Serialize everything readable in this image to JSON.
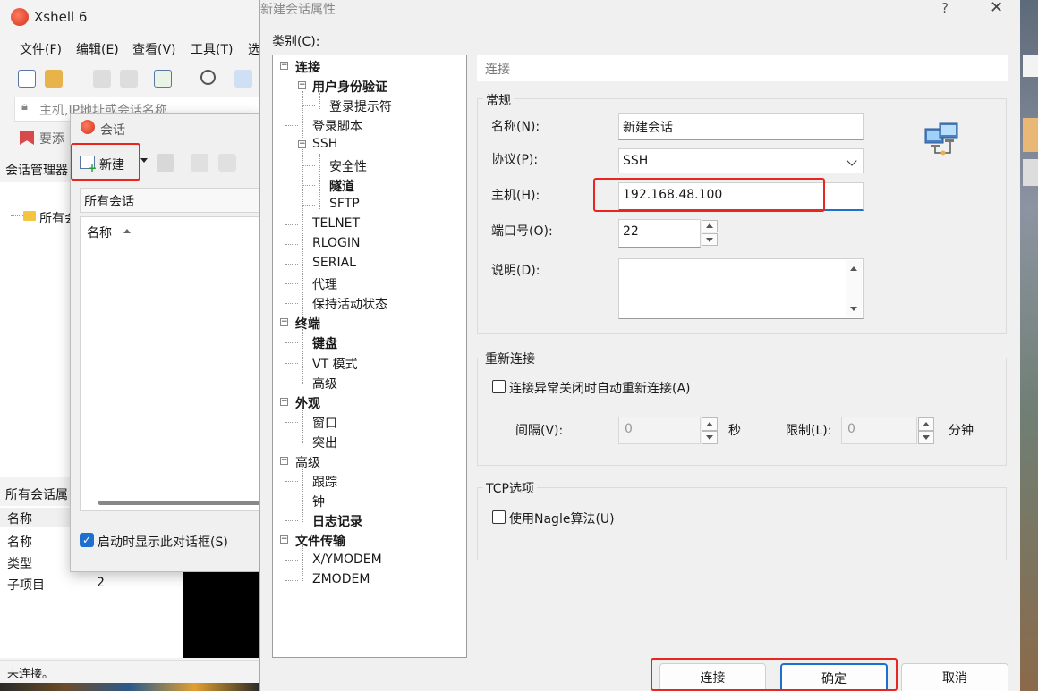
{
  "xshell": {
    "title": "Xshell 6",
    "menu": [
      "文件(F)",
      "编辑(E)",
      "查看(V)",
      "工具(T)",
      "选"
    ],
    "address_placeholder": "主机,IP地址或会话名称",
    "bookmark_text": "要添",
    "session_manager_label": "会话管理器",
    "tree_root": "所有会",
    "properties_title": "所有会话属",
    "properties": {
      "header": "名称",
      "rows": [
        {
          "key": "名称",
          "value": ""
        },
        {
          "key": "类型",
          "value": ""
        },
        {
          "key": "子项目",
          "value": "2"
        }
      ]
    },
    "status": "未连接。"
  },
  "sessions_dialog": {
    "title": "会话",
    "new_button": "新建",
    "filter_text": "所有会话",
    "list_column": "名称",
    "startup_checkbox": "启动时显示此对话框(S)",
    "startup_checked": true
  },
  "props_dialog": {
    "title": "新建会话属性",
    "help": "?",
    "close": "✕",
    "category_label": "类别(C):",
    "tree": [
      {
        "label": "连接",
        "level": 0,
        "bold": true,
        "box": "−"
      },
      {
        "label": "用户身份验证",
        "level": 1,
        "bold": true,
        "box": "−"
      },
      {
        "label": "登录提示符",
        "level": 2,
        "bold": false
      },
      {
        "label": "登录脚本",
        "level": 1,
        "bold": false
      },
      {
        "label": "SSH",
        "level": 1,
        "bold": false,
        "box": "−"
      },
      {
        "label": "安全性",
        "level": 2,
        "bold": false
      },
      {
        "label": "隧道",
        "level": 2,
        "bold": true
      },
      {
        "label": "SFTP",
        "level": 2,
        "bold": false
      },
      {
        "label": "TELNET",
        "level": 1,
        "bold": false
      },
      {
        "label": "RLOGIN",
        "level": 1,
        "bold": false
      },
      {
        "label": "SERIAL",
        "level": 1,
        "bold": false
      },
      {
        "label": "代理",
        "level": 1,
        "bold": false
      },
      {
        "label": "保持活动状态",
        "level": 1,
        "bold": false
      },
      {
        "label": "终端",
        "level": 0,
        "bold": true,
        "box": "−"
      },
      {
        "label": "键盘",
        "level": 1,
        "bold": true
      },
      {
        "label": "VT 模式",
        "level": 1,
        "bold": false
      },
      {
        "label": "高级",
        "level": 1,
        "bold": false
      },
      {
        "label": "外观",
        "level": 0,
        "bold": true,
        "box": "−"
      },
      {
        "label": "窗口",
        "level": 1,
        "bold": false
      },
      {
        "label": "突出",
        "level": 1,
        "bold": false
      },
      {
        "label": "高级",
        "level": 0,
        "bold": false,
        "box": "−"
      },
      {
        "label": "跟踪",
        "level": 1,
        "bold": false
      },
      {
        "label": "钟",
        "level": 1,
        "bold": false
      },
      {
        "label": "日志记录",
        "level": 1,
        "bold": true
      },
      {
        "label": "文件传输",
        "level": 0,
        "bold": true,
        "box": "−"
      },
      {
        "label": "X/YMODEM",
        "level": 1,
        "bold": false
      },
      {
        "label": "ZMODEM",
        "level": 1,
        "bold": false
      }
    ],
    "header": "连接",
    "general": {
      "title": "常规",
      "name_label": "名称(N):",
      "name_value": "新建会话",
      "protocol_label": "协议(P):",
      "protocol_value": "SSH",
      "host_label": "主机(H):",
      "host_value": "192.168.48.100",
      "port_label": "端口号(O):",
      "port_value": "22",
      "desc_label": "说明(D):",
      "desc_value": ""
    },
    "reconnect": {
      "title": "重新连接",
      "checkbox": "连接异常关闭时自动重新连接(A)",
      "checked": false,
      "interval_label": "间隔(V):",
      "interval_value": "0",
      "interval_unit": "秒",
      "limit_label": "限制(L):",
      "limit_value": "0",
      "limit_unit": "分钟"
    },
    "tcp": {
      "title": "TCP选项",
      "checkbox": "使用Nagle算法(U)",
      "checked": false
    },
    "buttons": {
      "connect": "连接",
      "ok": "确定",
      "cancel": "取消"
    }
  },
  "colors": {
    "highlight_red": "#e8251f",
    "accent_blue": "#1f6fd1"
  }
}
